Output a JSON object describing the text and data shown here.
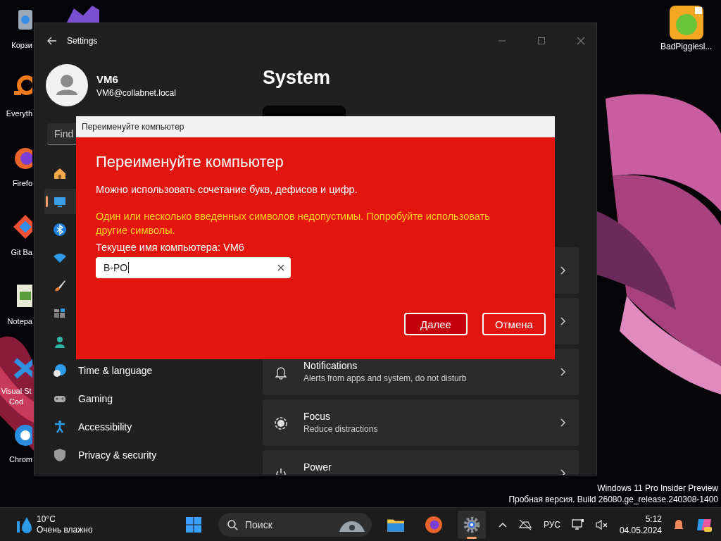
{
  "desktop": {
    "icons": [
      {
        "label": "Корзи"
      },
      {
        "label": "Everyth"
      },
      {
        "label": "Firefo"
      },
      {
        "label": "Git Ba"
      },
      {
        "label": "Notepa"
      },
      {
        "label": "Visual St Cod"
      },
      {
        "label": "Chrom"
      },
      {
        "label": "BadPiggiesl..."
      }
    ],
    "build_info": [
      "Windows 11 Pro Insider Preview",
      "Пробная версия. Build 26080.ge_release.240308-1400"
    ]
  },
  "settings": {
    "title": "Settings",
    "user": {
      "name": "VM6",
      "email": "VM6@collabnet.local"
    },
    "search": {
      "placeholder": "Find"
    },
    "nav": [
      {
        "selected": false
      },
      {
        "selected": true
      },
      {
        "selected": false
      },
      {
        "selected": false
      },
      {
        "selected": false
      },
      {
        "selected": false
      },
      {
        "selected": false
      },
      {
        "label": "Time & language",
        "selected": false
      },
      {
        "label": "Gaming",
        "selected": false
      },
      {
        "label": "Accessibility",
        "selected": false
      },
      {
        "label": "Privacy & security",
        "selected": false
      }
    ],
    "heading": "System",
    "cards": [
      {
        "kind": "link"
      },
      {
        "kind": "link"
      },
      {
        "kind": "link",
        "title": "Notifications",
        "description": "Alerts from apps and system, do not disturb"
      },
      {
        "kind": "link",
        "title": "Focus",
        "description": "Reduce distractions"
      },
      {
        "kind": "link",
        "title": "Power"
      }
    ]
  },
  "dialog": {
    "title_bar": "Переименуйте компьютер",
    "heading": "Переименуйте компьютер",
    "hint": "Можно использовать сочетание букв, дефисов и цифр.",
    "error": "Один или несколько введенных символов недопустимы. Попробуйте использовать другие символы.",
    "current_name": "Текущее имя компьютера: VM6",
    "input": {
      "value": "B-PO"
    },
    "buttons": [
      {
        "label": "Далее",
        "default": true
      },
      {
        "label": "Отмена",
        "default": false
      }
    ]
  },
  "taskbar": {
    "weather": {
      "temperature": "10°C",
      "condition": "Очень влажно"
    },
    "search": {
      "label": "Поиск"
    },
    "apps": [
      {
        "running": false
      },
      {
        "running": false
      },
      {
        "running": true
      }
    ],
    "language": "РУС",
    "time": "5:12",
    "date": "04.05.2024"
  }
}
